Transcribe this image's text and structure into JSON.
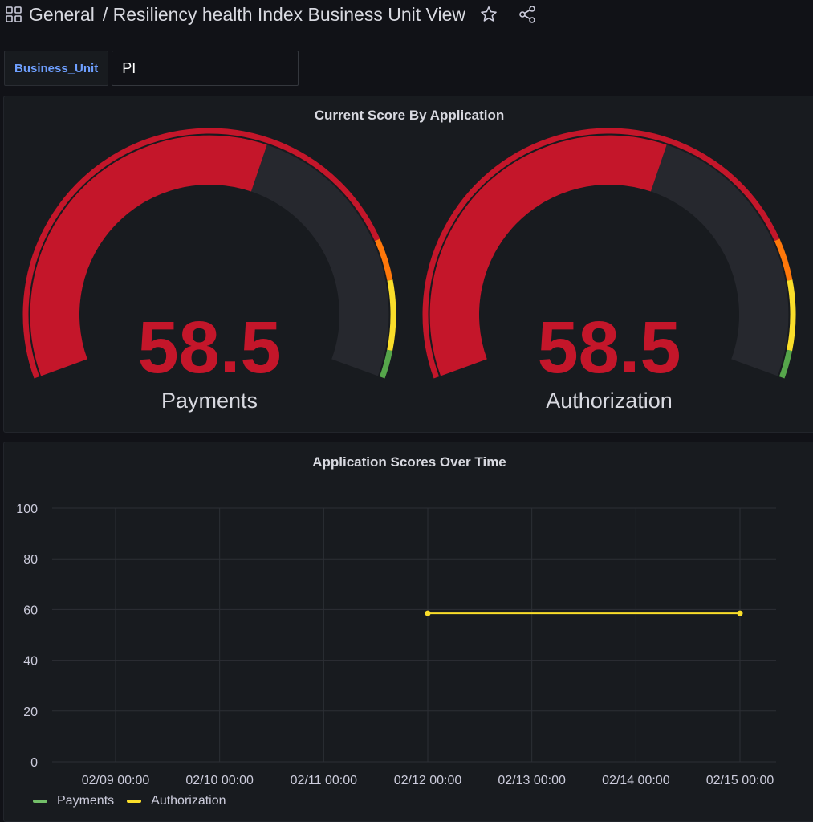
{
  "header": {
    "folder": "General",
    "separator": "/",
    "dashboard_title": "Resiliency health Index Business Unit View"
  },
  "variables": {
    "name": "Business_Unit",
    "value": "PI"
  },
  "gauge_panel": {
    "title": "Current Score By Application",
    "gauges": [
      {
        "label": "Payments",
        "value": 58.5,
        "value_text": "58.5",
        "min": 0,
        "max": 100
      },
      {
        "label": "Authorization",
        "value": 58.5,
        "value_text": "58.5",
        "min": 0,
        "max": 100
      }
    ],
    "thresholds": [
      {
        "from": 0,
        "to": 80,
        "color": "#c4162a"
      },
      {
        "from": 80,
        "to": 86,
        "color": "#ff780a"
      },
      {
        "from": 86,
        "to": 96,
        "color": "#fade2a"
      },
      {
        "from": 96,
        "to": 100,
        "color": "#56a64b"
      }
    ],
    "value_color": "#c4162a"
  },
  "timeseries_panel": {
    "title": "Application Scores Over Time"
  },
  "chart_data": {
    "type": "line",
    "title": "Application Scores Over Time",
    "x_ticks": [
      "02/09 00:00",
      "02/10 00:00",
      "02/11 00:00",
      "02/12 00:00",
      "02/13 00:00",
      "02/14 00:00",
      "02/15 00:00"
    ],
    "xlim": [
      "02/08 00:00",
      "02/15 00:00"
    ],
    "ylim": [
      0,
      100
    ],
    "y_ticks": [
      0,
      20,
      40,
      60,
      80,
      100
    ],
    "grid": true,
    "legend": "bottom-left",
    "series": [
      {
        "name": "Payments",
        "color": "#73bf69",
        "points": []
      },
      {
        "name": "Authorization",
        "color": "#fade2a",
        "points": [
          {
            "x": "02/12 00:00",
            "y": 58.5
          },
          {
            "x": "02/15 00:00",
            "y": 58.5
          }
        ]
      }
    ]
  }
}
